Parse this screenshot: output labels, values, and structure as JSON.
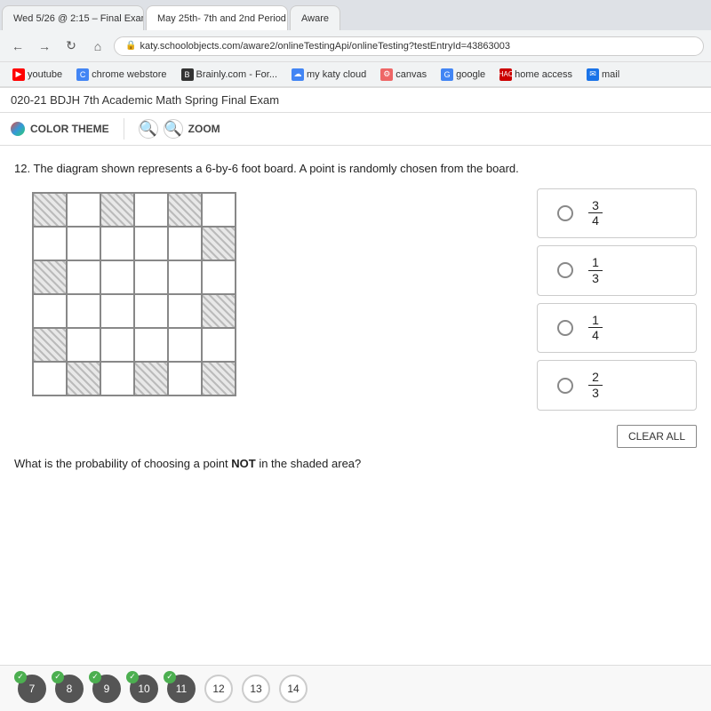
{
  "browser": {
    "tabs": [
      {
        "label": "Wed 5/26 @ 2:15 – Final Exam...",
        "active": false
      },
      {
        "label": "May 25th- 7th and 2nd Period",
        "active": true
      },
      {
        "label": "Aware",
        "active": false
      }
    ],
    "url": "katy.schoolobjects.com/aware2/onlineTestingApi/onlineTesting?testEntryId=43863003",
    "bookmarks": [
      {
        "label": "youtube",
        "icon": "Y"
      },
      {
        "label": "chrome webstore",
        "icon": "C"
      },
      {
        "label": "Brainly.com - For...",
        "icon": "B"
      },
      {
        "label": "my katy cloud",
        "icon": "☁"
      },
      {
        "label": "canvas",
        "icon": "⚙"
      },
      {
        "label": "google",
        "icon": "G"
      },
      {
        "label": "home access",
        "icon": "H"
      },
      {
        "label": "mail",
        "icon": "M"
      }
    ]
  },
  "page": {
    "title": "020-21 BDJH 7th Academic Math Spring Final Exam",
    "toolbar": {
      "color_theme_label": "COLOR THEME",
      "zoom_label": "ZOOM"
    },
    "question": {
      "number": "12.",
      "text": "The diagram shown represents a 6-by-6 foot board.  A point is randomly chosen from the board.",
      "prob_text_prefix": "What is the probability of choosing a point ",
      "prob_text_bold": "NOT",
      "prob_text_suffix": " in the shaded area?",
      "answers": [
        {
          "numerator": "3",
          "denominator": "4"
        },
        {
          "numerator": "1",
          "denominator": "3"
        },
        {
          "numerator": "1",
          "denominator": "4"
        },
        {
          "numerator": "2",
          "denominator": "3"
        }
      ],
      "clear_all_label": "CLEAR ALL"
    },
    "bottom_nav": {
      "questions": [
        {
          "num": "7",
          "answered": true
        },
        {
          "num": "8",
          "answered": true
        },
        {
          "num": "9",
          "answered": true
        },
        {
          "num": "10",
          "answered": true
        },
        {
          "num": "11",
          "answered": true
        },
        {
          "num": "12",
          "answered": false
        },
        {
          "num": "13",
          "answered": false
        },
        {
          "num": "14",
          "answered": false
        }
      ]
    }
  }
}
